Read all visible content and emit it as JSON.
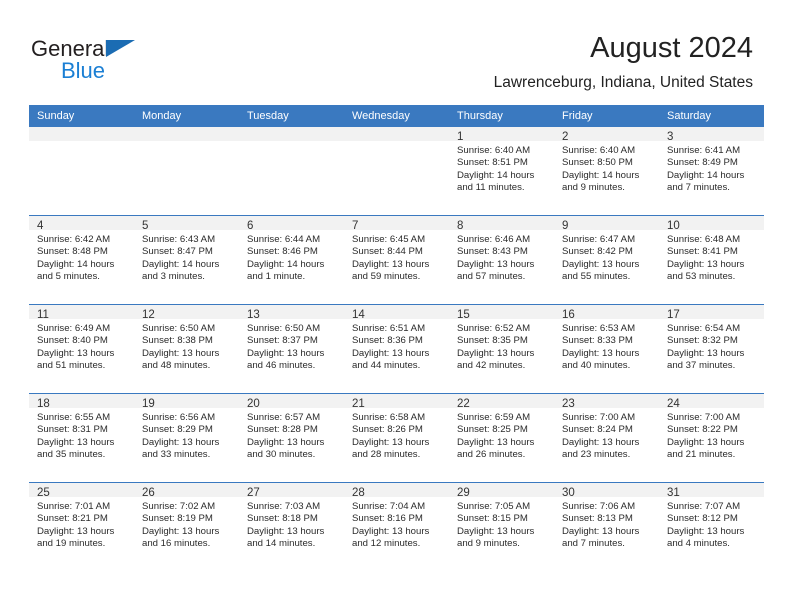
{
  "brand": {
    "line1": "General",
    "line2": "Blue",
    "triangle_color": "#1b6cb3",
    "line2_color": "#1b7fd4"
  },
  "header": {
    "title": "August 2024",
    "subtitle": "Lawrenceburg, Indiana, United States",
    "accent_color": "#3a79c0",
    "daynum_bg": "#f2f2f2"
  },
  "weekday_headers": [
    "Sunday",
    "Monday",
    "Tuesday",
    "Wednesday",
    "Thursday",
    "Friday",
    "Saturday"
  ],
  "labels": {
    "sunrise_prefix": "Sunrise:",
    "sunset_prefix": "Sunset:",
    "daylight_prefix": "Daylight:"
  },
  "weeks": [
    [
      {
        "day": "",
        "sunrise": "",
        "sunset": "",
        "daylight_line1": "",
        "daylight_line2": "",
        "blank": true
      },
      {
        "day": "",
        "sunrise": "",
        "sunset": "",
        "daylight_line1": "",
        "daylight_line2": "",
        "blank": true
      },
      {
        "day": "",
        "sunrise": "",
        "sunset": "",
        "daylight_line1": "",
        "daylight_line2": "",
        "blank": true
      },
      {
        "day": "",
        "sunrise": "",
        "sunset": "",
        "daylight_line1": "",
        "daylight_line2": "",
        "blank": true
      },
      {
        "day": "1",
        "sunrise": "Sunrise: 6:40 AM",
        "sunset": "Sunset: 8:51 PM",
        "daylight_line1": "Daylight: 14 hours",
        "daylight_line2": "and 11 minutes."
      },
      {
        "day": "2",
        "sunrise": "Sunrise: 6:40 AM",
        "sunset": "Sunset: 8:50 PM",
        "daylight_line1": "Daylight: 14 hours",
        "daylight_line2": "and 9 minutes."
      },
      {
        "day": "3",
        "sunrise": "Sunrise: 6:41 AM",
        "sunset": "Sunset: 8:49 PM",
        "daylight_line1": "Daylight: 14 hours",
        "daylight_line2": "and 7 minutes."
      }
    ],
    [
      {
        "day": "4",
        "sunrise": "Sunrise: 6:42 AM",
        "sunset": "Sunset: 8:48 PM",
        "daylight_line1": "Daylight: 14 hours",
        "daylight_line2": "and 5 minutes."
      },
      {
        "day": "5",
        "sunrise": "Sunrise: 6:43 AM",
        "sunset": "Sunset: 8:47 PM",
        "daylight_line1": "Daylight: 14 hours",
        "daylight_line2": "and 3 minutes."
      },
      {
        "day": "6",
        "sunrise": "Sunrise: 6:44 AM",
        "sunset": "Sunset: 8:46 PM",
        "daylight_line1": "Daylight: 14 hours",
        "daylight_line2": "and 1 minute."
      },
      {
        "day": "7",
        "sunrise": "Sunrise: 6:45 AM",
        "sunset": "Sunset: 8:44 PM",
        "daylight_line1": "Daylight: 13 hours",
        "daylight_line2": "and 59 minutes."
      },
      {
        "day": "8",
        "sunrise": "Sunrise: 6:46 AM",
        "sunset": "Sunset: 8:43 PM",
        "daylight_line1": "Daylight: 13 hours",
        "daylight_line2": "and 57 minutes."
      },
      {
        "day": "9",
        "sunrise": "Sunrise: 6:47 AM",
        "sunset": "Sunset: 8:42 PM",
        "daylight_line1": "Daylight: 13 hours",
        "daylight_line2": "and 55 minutes."
      },
      {
        "day": "10",
        "sunrise": "Sunrise: 6:48 AM",
        "sunset": "Sunset: 8:41 PM",
        "daylight_line1": "Daylight: 13 hours",
        "daylight_line2": "and 53 minutes."
      }
    ],
    [
      {
        "day": "11",
        "sunrise": "Sunrise: 6:49 AM",
        "sunset": "Sunset: 8:40 PM",
        "daylight_line1": "Daylight: 13 hours",
        "daylight_line2": "and 51 minutes."
      },
      {
        "day": "12",
        "sunrise": "Sunrise: 6:50 AM",
        "sunset": "Sunset: 8:38 PM",
        "daylight_line1": "Daylight: 13 hours",
        "daylight_line2": "and 48 minutes."
      },
      {
        "day": "13",
        "sunrise": "Sunrise: 6:50 AM",
        "sunset": "Sunset: 8:37 PM",
        "daylight_line1": "Daylight: 13 hours",
        "daylight_line2": "and 46 minutes."
      },
      {
        "day": "14",
        "sunrise": "Sunrise: 6:51 AM",
        "sunset": "Sunset: 8:36 PM",
        "daylight_line1": "Daylight: 13 hours",
        "daylight_line2": "and 44 minutes."
      },
      {
        "day": "15",
        "sunrise": "Sunrise: 6:52 AM",
        "sunset": "Sunset: 8:35 PM",
        "daylight_line1": "Daylight: 13 hours",
        "daylight_line2": "and 42 minutes."
      },
      {
        "day": "16",
        "sunrise": "Sunrise: 6:53 AM",
        "sunset": "Sunset: 8:33 PM",
        "daylight_line1": "Daylight: 13 hours",
        "daylight_line2": "and 40 minutes."
      },
      {
        "day": "17",
        "sunrise": "Sunrise: 6:54 AM",
        "sunset": "Sunset: 8:32 PM",
        "daylight_line1": "Daylight: 13 hours",
        "daylight_line2": "and 37 minutes."
      }
    ],
    [
      {
        "day": "18",
        "sunrise": "Sunrise: 6:55 AM",
        "sunset": "Sunset: 8:31 PM",
        "daylight_line1": "Daylight: 13 hours",
        "daylight_line2": "and 35 minutes."
      },
      {
        "day": "19",
        "sunrise": "Sunrise: 6:56 AM",
        "sunset": "Sunset: 8:29 PM",
        "daylight_line1": "Daylight: 13 hours",
        "daylight_line2": "and 33 minutes."
      },
      {
        "day": "20",
        "sunrise": "Sunrise: 6:57 AM",
        "sunset": "Sunset: 8:28 PM",
        "daylight_line1": "Daylight: 13 hours",
        "daylight_line2": "and 30 minutes."
      },
      {
        "day": "21",
        "sunrise": "Sunrise: 6:58 AM",
        "sunset": "Sunset: 8:26 PM",
        "daylight_line1": "Daylight: 13 hours",
        "daylight_line2": "and 28 minutes."
      },
      {
        "day": "22",
        "sunrise": "Sunrise: 6:59 AM",
        "sunset": "Sunset: 8:25 PM",
        "daylight_line1": "Daylight: 13 hours",
        "daylight_line2": "and 26 minutes."
      },
      {
        "day": "23",
        "sunrise": "Sunrise: 7:00 AM",
        "sunset": "Sunset: 8:24 PM",
        "daylight_line1": "Daylight: 13 hours",
        "daylight_line2": "and 23 minutes."
      },
      {
        "day": "24",
        "sunrise": "Sunrise: 7:00 AM",
        "sunset": "Sunset: 8:22 PM",
        "daylight_line1": "Daylight: 13 hours",
        "daylight_line2": "and 21 minutes."
      }
    ],
    [
      {
        "day": "25",
        "sunrise": "Sunrise: 7:01 AM",
        "sunset": "Sunset: 8:21 PM",
        "daylight_line1": "Daylight: 13 hours",
        "daylight_line2": "and 19 minutes."
      },
      {
        "day": "26",
        "sunrise": "Sunrise: 7:02 AM",
        "sunset": "Sunset: 8:19 PM",
        "daylight_line1": "Daylight: 13 hours",
        "daylight_line2": "and 16 minutes."
      },
      {
        "day": "27",
        "sunrise": "Sunrise: 7:03 AM",
        "sunset": "Sunset: 8:18 PM",
        "daylight_line1": "Daylight: 13 hours",
        "daylight_line2": "and 14 minutes."
      },
      {
        "day": "28",
        "sunrise": "Sunrise: 7:04 AM",
        "sunset": "Sunset: 8:16 PM",
        "daylight_line1": "Daylight: 13 hours",
        "daylight_line2": "and 12 minutes."
      },
      {
        "day": "29",
        "sunrise": "Sunrise: 7:05 AM",
        "sunset": "Sunset: 8:15 PM",
        "daylight_line1": "Daylight: 13 hours",
        "daylight_line2": "and 9 minutes."
      },
      {
        "day": "30",
        "sunrise": "Sunrise: 7:06 AM",
        "sunset": "Sunset: 8:13 PM",
        "daylight_line1": "Daylight: 13 hours",
        "daylight_line2": "and 7 minutes."
      },
      {
        "day": "31",
        "sunrise": "Sunrise: 7:07 AM",
        "sunset": "Sunset: 8:12 PM",
        "daylight_line1": "Daylight: 13 hours",
        "daylight_line2": "and 4 minutes."
      }
    ]
  ]
}
